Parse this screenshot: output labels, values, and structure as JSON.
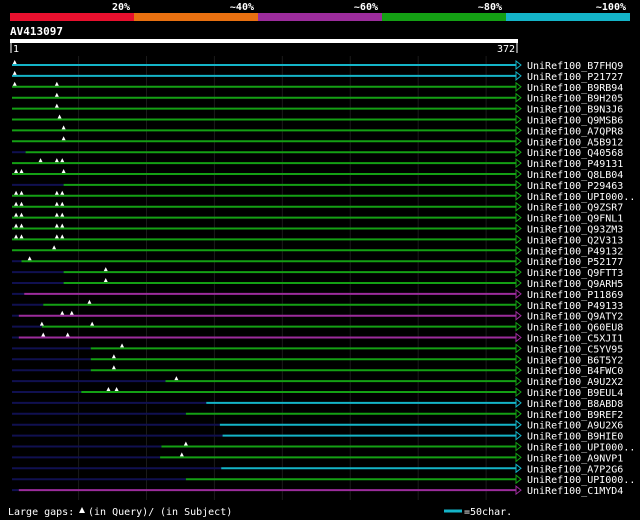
{
  "legend": {
    "labels": [
      "20%",
      "~40%",
      "~60%",
      "~80%",
      "~100%"
    ],
    "colors": [
      "#e8102e",
      "#e87010",
      "#9c2c9c",
      "#14a014",
      "#14b4c8"
    ]
  },
  "query": {
    "name": "AV413097",
    "start": "1",
    "end": "372"
  },
  "footer": {
    "gaps_label": "Large gaps:",
    "in_query": "(in Query)/",
    "in_subject": "(in Subject)",
    "scale_label": "=50char."
  },
  "hits": [
    {
      "name": "UniRef100_B7FHQ9",
      "color": "#14b4c8",
      "start": 1,
      "end": 372,
      "gap_marks": [
        3
      ]
    },
    {
      "name": "UniRef100_P21727",
      "color": "#14b4c8",
      "start": 1,
      "end": 372,
      "gap_marks": [
        3
      ]
    },
    {
      "name": "UniRef100_B9RB94",
      "color": "#14a014",
      "start": 1,
      "end": 372,
      "gap_marks": [
        3,
        34
      ]
    },
    {
      "name": "UniRef100_B9H205",
      "color": "#14a014",
      "start": 1,
      "end": 372,
      "gap_marks": [
        34
      ]
    },
    {
      "name": "UniRef100_B9N3J6",
      "color": "#14a014",
      "start": 1,
      "end": 372,
      "gap_marks": [
        34
      ]
    },
    {
      "name": "UniRef100_Q9MSB6",
      "color": "#14a014",
      "start": 1,
      "end": 372,
      "gap_marks": [
        36
      ]
    },
    {
      "name": "UniRef100_A7QPR8",
      "color": "#14a014",
      "start": 1,
      "end": 372,
      "gap_marks": [
        39
      ]
    },
    {
      "name": "UniRef100_A5B912",
      "color": "#14a014",
      "start": 1,
      "end": 372,
      "gap_marks": [
        39
      ]
    },
    {
      "name": "UniRef100_Q40568",
      "color": "#14a014",
      "start": 11,
      "end": 372,
      "gap_marks": []
    },
    {
      "name": "UniRef100_P49131",
      "color": "#14a014",
      "start": 1,
      "end": 372,
      "gap_marks": [
        22,
        34,
        38
      ]
    },
    {
      "name": "UniRef100_Q8LB04",
      "color": "#14a014",
      "start": 1,
      "end": 372,
      "gap_marks": [
        4,
        8,
        39
      ]
    },
    {
      "name": "UniRef100_P29463",
      "color": "#14a014",
      "start": 39,
      "end": 372,
      "gap_marks": []
    },
    {
      "name": "UniRef100_UPI000..",
      "color": "#14a014",
      "start": 1,
      "end": 372,
      "gap_marks": [
        4,
        8,
        34,
        38
      ]
    },
    {
      "name": "UniRef100_Q9ZSR7",
      "color": "#14a014",
      "start": 1,
      "end": 372,
      "gap_marks": [
        4,
        8,
        34,
        38
      ]
    },
    {
      "name": "UniRef100_Q9FNL1",
      "color": "#14a014",
      "start": 1,
      "end": 372,
      "gap_marks": [
        4,
        8,
        34,
        38
      ]
    },
    {
      "name": "UniRef100_Q93ZM3",
      "color": "#14a014",
      "start": 1,
      "end": 372,
      "gap_marks": [
        4,
        8,
        34,
        38
      ]
    },
    {
      "name": "UniRef100_Q2V313",
      "color": "#14a014",
      "start": 1,
      "end": 372,
      "gap_marks": [
        4,
        8,
        34,
        38
      ]
    },
    {
      "name": "UniRef100_P49132",
      "color": "#14a014",
      "start": 1,
      "end": 372,
      "gap_marks": [
        32
      ]
    },
    {
      "name": "UniRef100_P52177",
      "color": "#14a014",
      "start": 8,
      "end": 372,
      "gap_marks": [
        14
      ]
    },
    {
      "name": "UniRef100_Q9FTT3",
      "color": "#14a014",
      "start": 39,
      "end": 372,
      "gap_marks": [
        70
      ]
    },
    {
      "name": "UniRef100_Q9ARH5",
      "color": "#14a014",
      "start": 39,
      "end": 372,
      "gap_marks": [
        70
      ]
    },
    {
      "name": "UniRef100_P11869",
      "color": "#9c2c9c",
      "start": 10,
      "end": 372,
      "gap_marks": []
    },
    {
      "name": "UniRef100_P49133",
      "color": "#14a014",
      "start": 24,
      "end": 372,
      "gap_marks": [
        58
      ]
    },
    {
      "name": "UniRef100_Q9ATY2",
      "color": "#9c2c9c",
      "start": 6,
      "end": 372,
      "gap_marks": [
        38,
        45
      ]
    },
    {
      "name": "UniRef100_Q60EU8",
      "color": "#14a014",
      "start": 23,
      "end": 372,
      "gap_marks": [
        23,
        60
      ]
    },
    {
      "name": "UniRef100_C5XJI1",
      "color": "#9c2c9c",
      "start": 6,
      "end": 372,
      "gap_marks": [
        24,
        42
      ]
    },
    {
      "name": "UniRef100_C5YV95",
      "color": "#14a014",
      "start": 59,
      "end": 372,
      "gap_marks": [
        82
      ]
    },
    {
      "name": "UniRef100_B6T5Y2",
      "color": "#14a014",
      "start": 59,
      "end": 372,
      "gap_marks": [
        76
      ]
    },
    {
      "name": "UniRef100_B4FWC0",
      "color": "#14a014",
      "start": 59,
      "end": 372,
      "gap_marks": [
        76
      ]
    },
    {
      "name": "UniRef100_A9U2X2",
      "color": "#14a014",
      "start": 114,
      "end": 372,
      "gap_marks": [
        122
      ]
    },
    {
      "name": "UniRef100_B9EUL4",
      "color": "#14a014",
      "start": 52,
      "end": 372,
      "gap_marks": [
        72,
        78
      ]
    },
    {
      "name": "UniRef100_B8ABD8",
      "color": "#14b4c8",
      "start": 144,
      "end": 372,
      "gap_marks": []
    },
    {
      "name": "UniRef100_B9REF2",
      "color": "#14a014",
      "start": 129,
      "end": 372,
      "gap_marks": []
    },
    {
      "name": "UniRef100_A9U2X6",
      "color": "#14b4c8",
      "start": 154,
      "end": 372,
      "gap_marks": []
    },
    {
      "name": "UniRef100_B9HIE0",
      "color": "#14b4c8",
      "start": 156,
      "end": 372,
      "gap_marks": []
    },
    {
      "name": "UniRef100_UPI000..",
      "color": "#14a014",
      "start": 111,
      "end": 372,
      "gap_marks": [
        129
      ]
    },
    {
      "name": "UniRef100_A9NVP1",
      "color": "#14a014",
      "start": 110,
      "end": 372,
      "gap_marks": [
        126
      ]
    },
    {
      "name": "UniRef100_A7P2G6",
      "color": "#14b4c8",
      "start": 155,
      "end": 372,
      "gap_marks": []
    },
    {
      "name": "UniRef100_UPI000..",
      "color": "#14a014",
      "start": 129,
      "end": 372,
      "gap_marks": []
    },
    {
      "name": "UniRef100_C1MYD4",
      "color": "#9c2c9c",
      "start": 6,
      "end": 372,
      "gap_marks": []
    }
  ]
}
